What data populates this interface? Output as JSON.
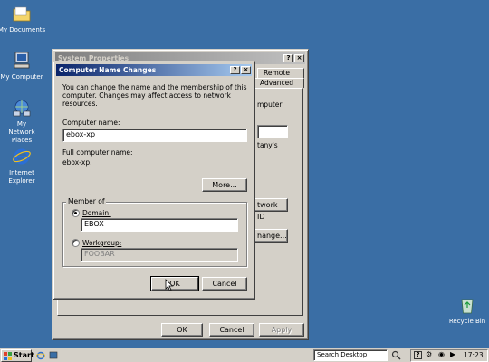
{
  "desktop": {
    "icons": [
      {
        "label": "My Documents"
      },
      {
        "label": "My Computer"
      },
      {
        "label": "My Network Places"
      },
      {
        "label": "Internet Explorer"
      },
      {
        "label": "Recycle Bin"
      }
    ]
  },
  "system_properties": {
    "title": "System Properties",
    "tabs": [
      "Remote",
      "Advanced"
    ],
    "right_labels": [
      "mputer",
      "tany's"
    ],
    "network_id_label": "twork ID",
    "change_label": "hange...",
    "ok_label": "OK",
    "cancel_label": "Cancel",
    "apply_label": "Apply"
  },
  "dialog": {
    "title": "Computer Name Changes",
    "intro": "You can change the name and the membership of this computer. Changes may affect access to network resources.",
    "computer_name_label": "Computer name:",
    "computer_name_value": "ebox-xp",
    "full_name_label": "Full computer name:",
    "full_name_value": "ebox-xp.",
    "more_label": "More...",
    "member_of_label": "Member of",
    "domain_label": "Domain:",
    "domain_value": "EBOX",
    "workgroup_label": "Workgroup:",
    "workgroup_value": "FOOBAR",
    "ok_label": "OK",
    "cancel_label": "Cancel",
    "help_glyph": "?",
    "close_glyph": "×"
  },
  "taskbar": {
    "start_label": "Start",
    "search_placeholder": "Search Desktop",
    "clock": "17:23"
  }
}
